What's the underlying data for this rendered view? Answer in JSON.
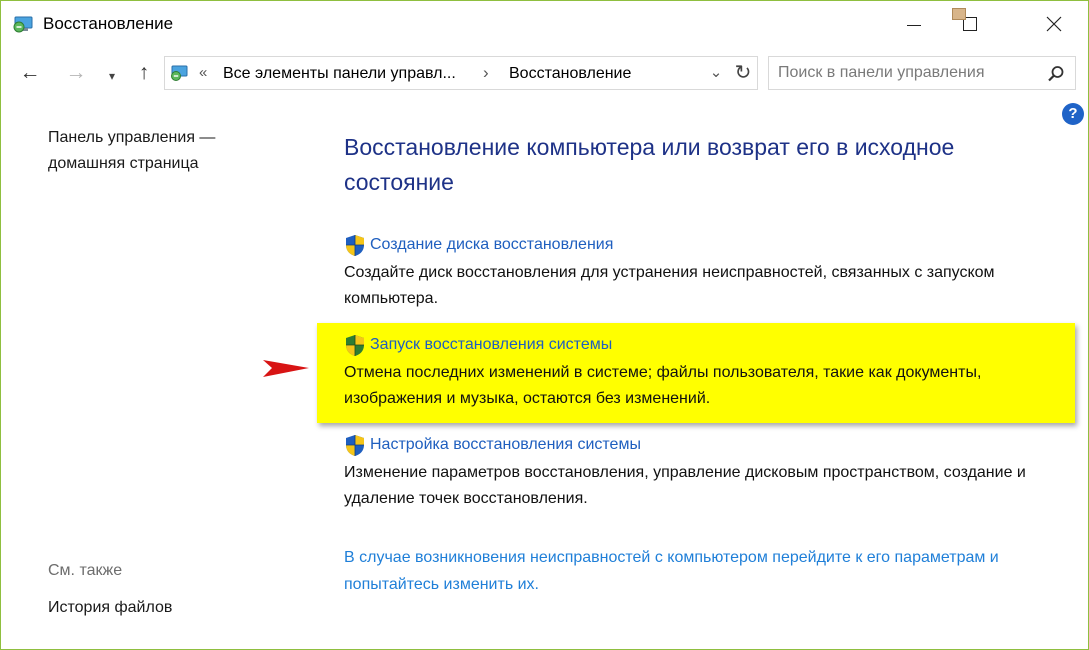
{
  "window": {
    "title": "Восстановление"
  },
  "address_bar": {
    "overflow_chevron": "«",
    "crumb_1": "Все элементы панели управл...",
    "separator": "›",
    "crumb_2": "Восстановление"
  },
  "search": {
    "placeholder": "Поиск в панели управления"
  },
  "help": {
    "label": "?"
  },
  "sidebar": {
    "home_link": "Панель управления — домашняя страница",
    "see_also_label": "См. также",
    "file_history_link": "История файлов"
  },
  "main": {
    "heading": "Восстановление компьютера или возврат его в исходное состояние",
    "tasks": [
      {
        "title": "Создание диска восстановления",
        "description": "Создайте диск восстановления для устранения неисправностей, связанных с запуском компьютера."
      },
      {
        "title": "Запуск восстановления системы",
        "description": "Отмена последних изменений в системе; файлы пользователя, такие как документы, изображения и музыка, остаются без изменений."
      },
      {
        "title": "Настройка восстановления системы",
        "description": "Изменение параметров восстановления, управление дисковым пространством, создание и удаление точек восстановления."
      }
    ],
    "troubleshoot_link": "В случае возникновения неисправностей с компьютером перейдите к его параметрам и попытайтесь изменить их."
  },
  "colors": {
    "heading": "#1e3287",
    "link": "#1f5fbf",
    "highlight": "#ffff00",
    "annotation_arrow": "#e01b1b"
  },
  "icons": {
    "app": "control-panel-icon",
    "task": "uac-shield-icon",
    "search": "search-icon"
  }
}
